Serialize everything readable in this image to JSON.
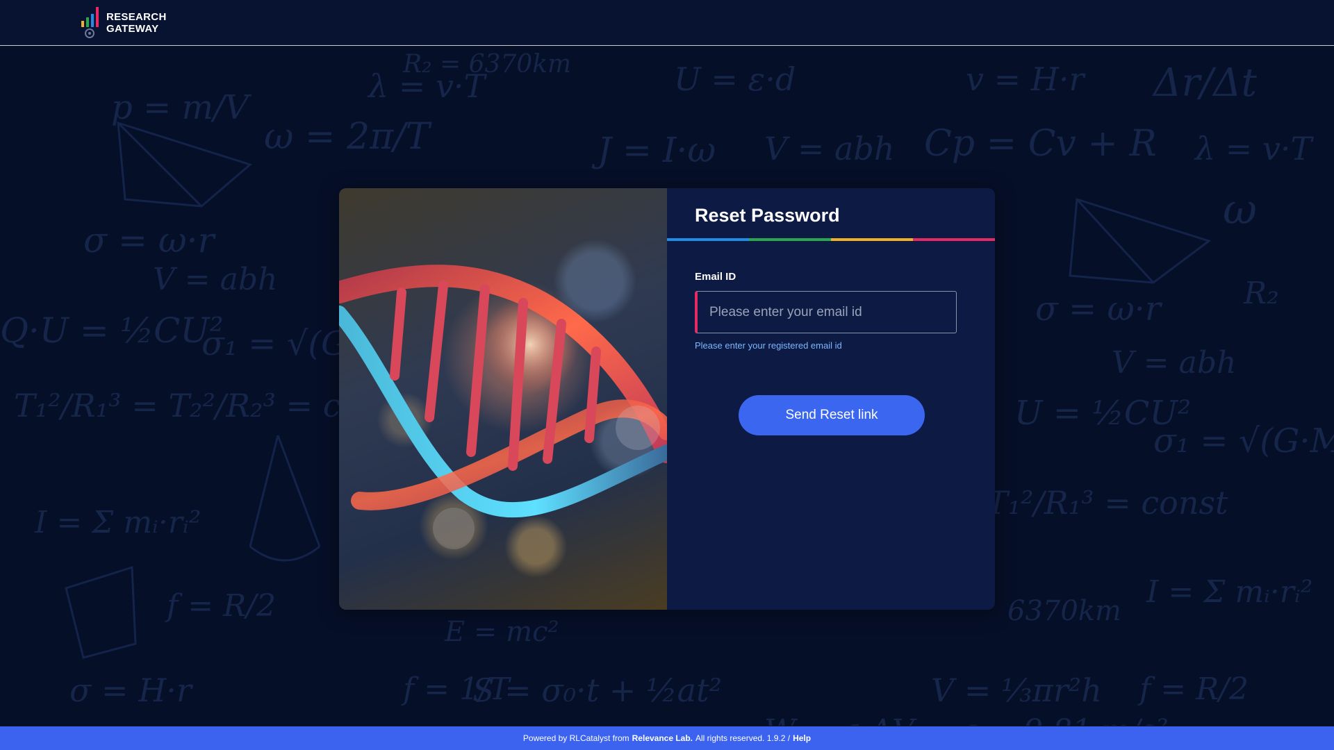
{
  "header": {
    "logo_line1": "RESEARCH",
    "logo_line2": "GATEWAY"
  },
  "form": {
    "title": "Reset Password",
    "email_label": "Email ID",
    "email_placeholder": "Please enter your email id",
    "email_value": "",
    "hint": "Please enter your registered email id",
    "submit_label": "Send Reset link"
  },
  "footer": {
    "prefix": "Powered by RLCatalyst from",
    "company": "Relevance Lab.",
    "rights": "All rights reserved. 1.9.2 /",
    "help": "Help"
  },
  "colors": {
    "accent_blue": "#3b66f0",
    "rainbow": [
      "#1f8ce6",
      "#29a84f",
      "#f0b12a",
      "#e62a63"
    ],
    "input_marker": "#e62a63"
  }
}
